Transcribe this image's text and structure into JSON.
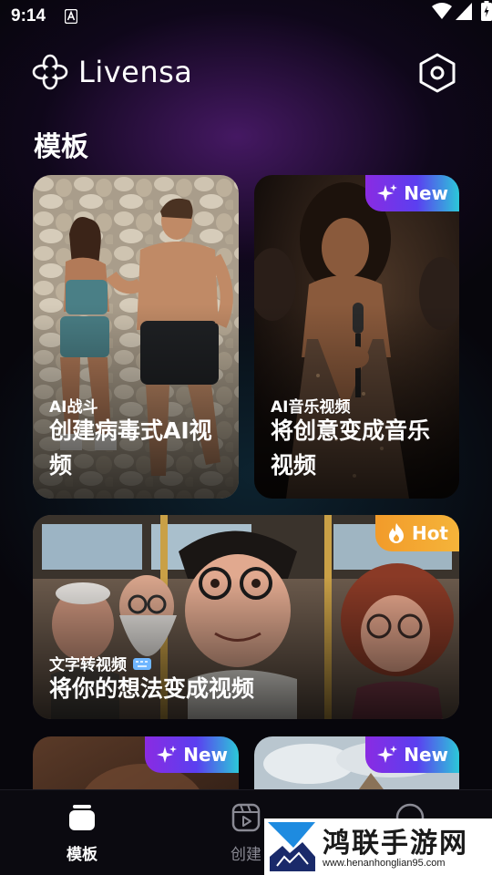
{
  "status_bar": {
    "time": "9:14",
    "icons": [
      "a-notification-icon",
      "wifi-icon",
      "signal-icon",
      "battery-icon"
    ]
  },
  "header": {
    "app_name": "Livensa",
    "logo_icon": "flower-logo-icon",
    "settings_icon": "hexagon-settings-icon"
  },
  "section": {
    "title": "模板"
  },
  "cards": [
    {
      "tag": "AI战斗",
      "title_line1": "创建病毒式AI视",
      "title_line2": "频",
      "badge": ""
    },
    {
      "tag": "AI音乐视频",
      "title_line1": "将创意变成音乐",
      "title_line2": "视频",
      "badge": "New"
    },
    {
      "tag": "文字转视频",
      "title_line1": "将你的想法变成视频",
      "badge": "Hot"
    },
    {
      "badge": "New"
    },
    {
      "badge": "New"
    }
  ],
  "bottom_nav": {
    "items": [
      {
        "label": "模板",
        "icon": "templates-icon",
        "active": true
      },
      {
        "label": "创建",
        "icon": "create-video-icon",
        "active": false
      },
      {
        "label": "",
        "icon": "profile-icon",
        "active": false
      }
    ]
  },
  "watermark": {
    "title": "鸿联手游网",
    "url": "www.henanhonglian95.com"
  },
  "colors": {
    "badge_new_start": "#8a2be2",
    "badge_new_end": "#2cc8d8",
    "badge_hot": "#f5a430",
    "nav_active": "#ffffff",
    "nav_inactive": "#8a8a94"
  }
}
